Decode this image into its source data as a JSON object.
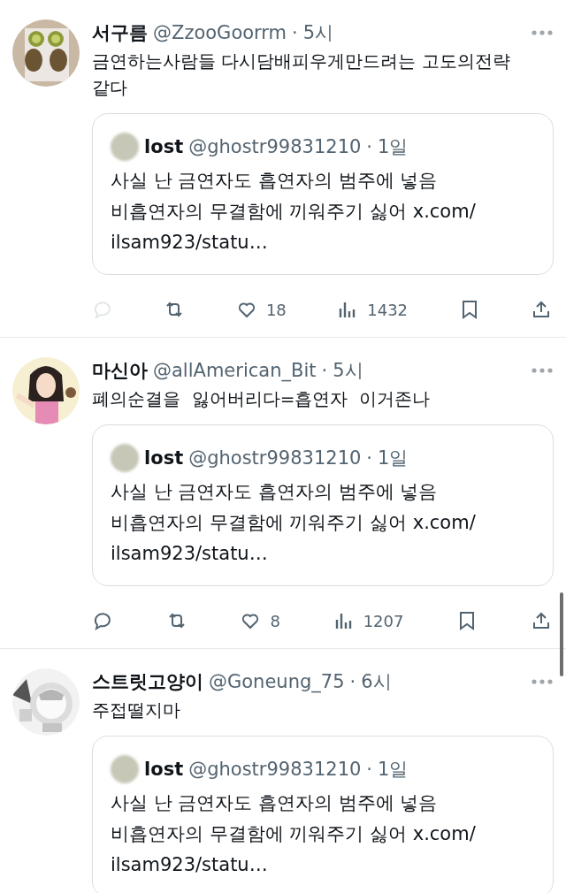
{
  "tweets": [
    {
      "name": "서구름",
      "handle": "@ZzooGoorrm",
      "separator": "·",
      "time": "5시",
      "text": "금연하는사람들 다시담배피우게만드려는 고도의전략\n같다",
      "quote": {
        "name": "lost",
        "handle": "@ghostr99831210",
        "separator": "·",
        "time": "1일",
        "text": "사실 난 금연자도 흡연자의 범주에 넣음\n비흡연자의 무결함에 끼워주기 싫어 x.com/\nilsam923/statu…"
      },
      "actions": [
        {
          "kind": "reply",
          "disabled": true
        },
        {
          "kind": "retweet"
        },
        {
          "kind": "like",
          "count": "18"
        },
        {
          "kind": "views",
          "count": "1432"
        },
        {
          "kind": "bookmark"
        },
        {
          "kind": "share"
        }
      ]
    },
    {
      "name": "마신아",
      "handle": "@allAmerican_Bit",
      "separator": "·",
      "time": "5시",
      "text": "폐의순결을  잃어버리다=흡연자  이거존나",
      "quote": {
        "name": "lost",
        "handle": "@ghostr99831210",
        "separator": "·",
        "time": "1일",
        "text": "사실 난 금연자도 흡연자의 범주에 넣음\n비흡연자의 무결함에 끼워주기 싫어 x.com/\nilsam923/statu…"
      },
      "actions": [
        {
          "kind": "reply",
          "disabled": false
        },
        {
          "kind": "retweet"
        },
        {
          "kind": "like",
          "count": "8"
        },
        {
          "kind": "views",
          "count": "1207"
        },
        {
          "kind": "bookmark"
        },
        {
          "kind": "share"
        }
      ]
    },
    {
      "name": "스트릿고양이",
      "handle": "@Goneung_75",
      "separator": "·",
      "time": "6시",
      "text": "주접떨지마",
      "quote": {
        "name": "lost",
        "handle": "@ghostr99831210",
        "separator": "·",
        "time": "1일",
        "text": "사실 난 금연자도 흡연자의 범주에 넣음\n비흡연자의 무결함에 끼워주기 싫어 x.com/\nilsam923/statu…"
      }
    }
  ]
}
